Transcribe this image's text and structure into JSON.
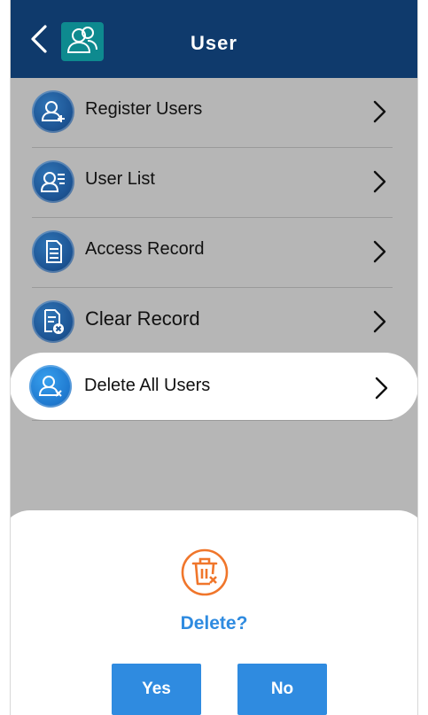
{
  "header": {
    "title": "User"
  },
  "menu": {
    "items": [
      {
        "label": "Register Users"
      },
      {
        "label": "User List"
      },
      {
        "label": "Access Record"
      },
      {
        "label": "Clear Record"
      },
      {
        "label": "Delete All Users"
      }
    ]
  },
  "dialog": {
    "title": "Delete?",
    "yes_label": "Yes",
    "no_label": "No"
  },
  "icons": {
    "back": "chevron-left-icon",
    "header": "users-icon",
    "register": "user-plus-icon",
    "list": "user-list-icon",
    "access": "document-icon",
    "clear": "document-delete-icon",
    "delete_all": "user-delete-icon",
    "dialog": "trash-icon",
    "chevron": "chevron-right-icon"
  },
  "colors": {
    "header_bg": "#0f3a6c",
    "header_icon_bg": "#0e8a8f",
    "content_bg": "#b6b6b6",
    "accent": "#2f8be0",
    "warning": "#f0762b"
  }
}
